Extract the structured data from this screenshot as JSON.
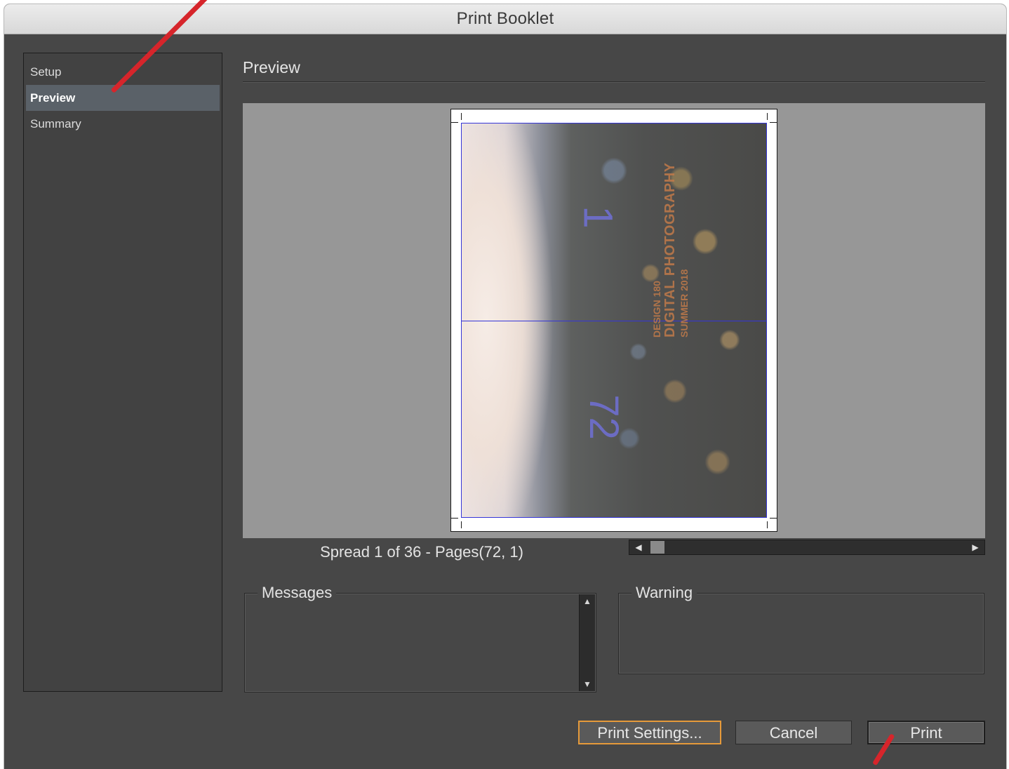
{
  "window": {
    "title": "Print Booklet"
  },
  "sidebar": {
    "items": [
      {
        "label": "Setup",
        "active": false
      },
      {
        "label": "Preview",
        "active": true
      },
      {
        "label": "Summary",
        "active": false
      }
    ]
  },
  "preview": {
    "section_title": "Preview",
    "spread_label": "Spread 1 of 36 - Pages(72, 1)",
    "cover": {
      "page_top": "1",
      "page_bottom": "72",
      "line1": "DESIGN 180",
      "line2": "DIGITAL PHOTOGRAPHY",
      "line3": "SUMMER 2018"
    }
  },
  "messages": {
    "label": "Messages",
    "text": ""
  },
  "warning": {
    "label": "Warning",
    "text": ""
  },
  "buttons": {
    "print_settings": "Print Settings...",
    "cancel": "Cancel",
    "print": "Print"
  },
  "colors": {
    "window_bg": "#474747",
    "focus_ring": "#e69a3a",
    "annotation_arrow": "#d6252b",
    "bleed_guide": "#3535d8"
  },
  "icons": {
    "scroll_left": "triangle-left-icon",
    "scroll_right": "triangle-right-icon",
    "scroll_up": "triangle-up-icon",
    "scroll_down": "triangle-down-icon"
  }
}
